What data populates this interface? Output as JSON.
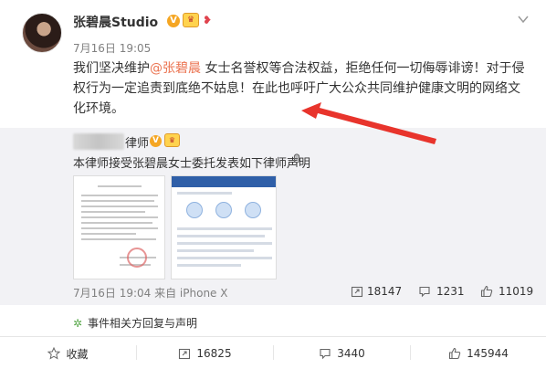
{
  "post": {
    "author": "张碧晨Studio",
    "time": "7月16日 19:05",
    "text_before": "我们坚决维护",
    "mention": "@张碧晨",
    "text_after": " 女士名誉权等合法权益，拒绝任何一切侮辱诽谤！对于侵权行为一定追责到底绝不姑息！在此也呼吁广大公众共同维护健康文明的网络文化环境。",
    "badge_v": "V"
  },
  "repost": {
    "author_suffix": "律师",
    "text": "本律师接受张碧晨女士委托发表如下律师声明",
    "meta": "7月16日 19:04 来自 iPhone X",
    "reposts": "18147",
    "comments": "1231",
    "likes": "11019"
  },
  "event": {
    "label": "事件相关方回复与声明"
  },
  "actions": {
    "favorite": "收藏",
    "repost": "16825",
    "comment": "3440",
    "like": "145944"
  },
  "colors": {
    "accent": "#eb7350",
    "arrow": "#e8342c",
    "repost_bg": "#f2f2f5",
    "event_icon": "#59a84b"
  }
}
